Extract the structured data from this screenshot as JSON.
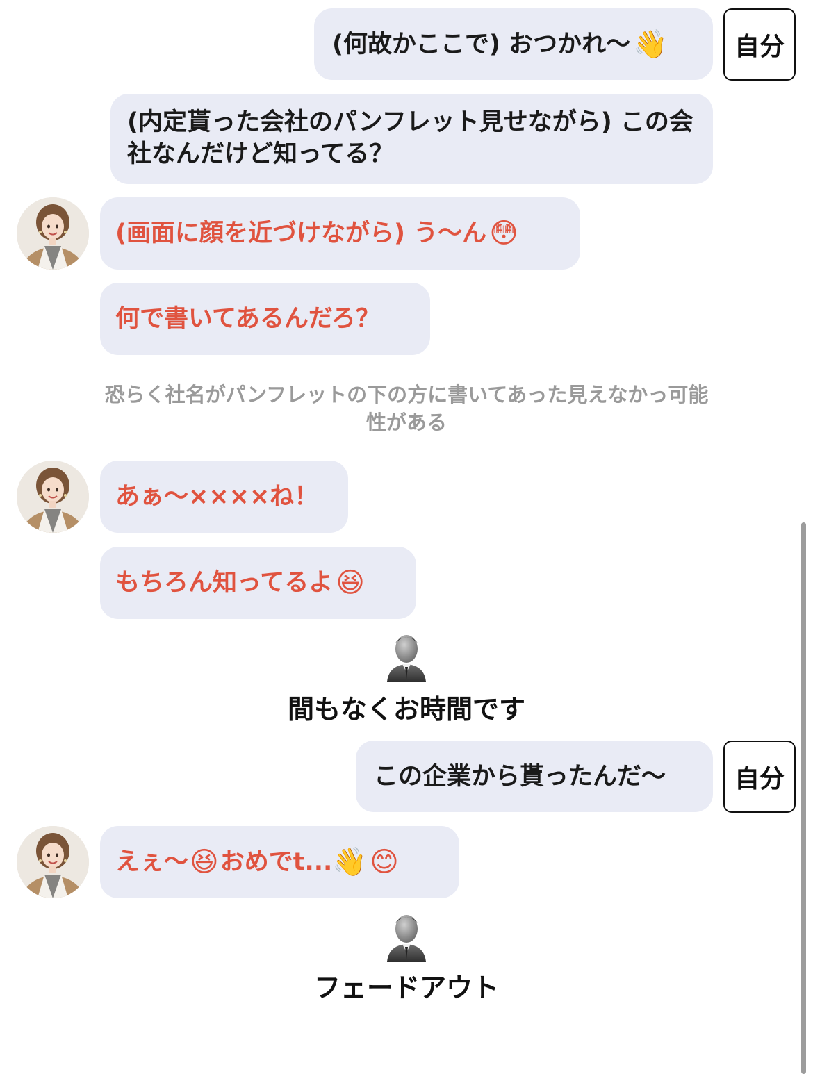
{
  "self_tag_label": "自分",
  "messages": {
    "m1": {
      "text": "(何故かここで) おつかれ〜",
      "emoji": "👋"
    },
    "m2": {
      "text": "(内定貰った会社のパンフレット見せながら) この会社なんだけど知ってる？"
    },
    "m3": {
      "text": "(画面に顔を近づけながら) う〜ん",
      "emoji": "😳"
    },
    "m4": {
      "text": "何で書いてあるんだろ？"
    },
    "narration": "恐らく社名がパンフレットの下の方に書いてあった見えなかっ可能性がある",
    "m5": {
      "text": "あぁ〜××××ね！"
    },
    "m6": {
      "text": "もちろん知ってるよ",
      "emoji": "😆"
    },
    "system1": "間もなくお時間です",
    "m7": {
      "text": "この企業から貰ったんだ〜"
    },
    "m8": {
      "part1": "えぇ〜",
      "emoji1": "😆",
      "part2": "おめでt...",
      "emoji2": "👋",
      "emoji3": "😊"
    },
    "system2": "フェードアウト"
  },
  "icons": {
    "avatar": "avatar-photo",
    "system": "businessman-icon"
  },
  "colors": {
    "bubble": "#e9ebf5",
    "other_text": "#e0533f",
    "self_text": "#1a1a1a",
    "narration": "#9a9a9a"
  }
}
